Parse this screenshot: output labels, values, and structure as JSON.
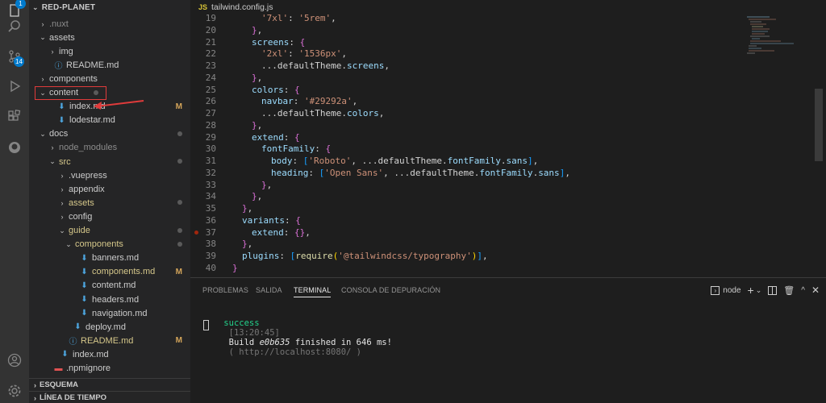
{
  "activity_bar": {
    "explorer_badge": "1",
    "scm_badge": "14",
    "items": [
      "files-icon",
      "search-icon",
      "source-control-icon",
      "run-debug-icon",
      "extensions-icon",
      "github-icon",
      "account-icon",
      "settings-icon"
    ]
  },
  "sidebar": {
    "title": "RED-PLANET",
    "tree": [
      {
        "label": ".nuxt",
        "chev": "›",
        "status": ""
      },
      {
        "label": "assets",
        "chev": "⌄",
        "status": ""
      },
      {
        "label": "img",
        "chev": "›",
        "status": ""
      },
      {
        "label": "README.md",
        "chev": "",
        "status": ""
      },
      {
        "label": "components",
        "chev": "›",
        "status": ""
      },
      {
        "label": "content",
        "chev": "⌄",
        "status": "dot"
      },
      {
        "label": "index.md",
        "chev": "",
        "status": "M"
      },
      {
        "label": "lodestar.md",
        "chev": "",
        "status": ""
      },
      {
        "label": "docs",
        "chev": "⌄",
        "status": "dot"
      },
      {
        "label": "node_modules",
        "chev": "›",
        "status": ""
      },
      {
        "label": "src",
        "chev": "⌄",
        "status": "dot"
      },
      {
        "label": ".vuepress",
        "chev": "›",
        "status": ""
      },
      {
        "label": "appendix",
        "chev": "›",
        "status": ""
      },
      {
        "label": "assets",
        "chev": "›",
        "status": "dot"
      },
      {
        "label": "config",
        "chev": "›",
        "status": ""
      },
      {
        "label": "guide",
        "chev": "⌄",
        "status": "dot"
      },
      {
        "label": "components",
        "chev": "⌄",
        "status": "dot"
      },
      {
        "label": "banners.md",
        "chev": "",
        "status": ""
      },
      {
        "label": "components.md",
        "chev": "",
        "status": "M"
      },
      {
        "label": "content.md",
        "chev": "",
        "status": ""
      },
      {
        "label": "headers.md",
        "chev": "",
        "status": ""
      },
      {
        "label": "navigation.md",
        "chev": "",
        "status": ""
      },
      {
        "label": "deploy.md",
        "chev": "",
        "status": ""
      },
      {
        "label": "README.md",
        "chev": "",
        "status": "M"
      },
      {
        "label": "index.md",
        "chev": "",
        "status": ""
      },
      {
        "label": ".npmignore",
        "chev": "",
        "status": ""
      }
    ],
    "sections": [
      "ESQUEMA",
      "LÍNEA DE TIEMPO"
    ]
  },
  "editor": {
    "tab_label": "tailwind.config.js",
    "tab_icon": "JS",
    "line_numbers": [
      "19",
      "20",
      "21",
      "22",
      "23",
      "24",
      "25",
      "26",
      "27",
      "28",
      "29",
      "30",
      "31",
      "32",
      "33",
      "34",
      "35",
      "36",
      "37",
      "38",
      "39",
      "40"
    ],
    "lines": [
      "'7xl': '5rem',",
      "},",
      "screens: {",
      "'2xl': '1536px',",
      "...defaultTheme.screens,",
      "},",
      "colors: {",
      "navbar: '#29292a',",
      "...defaultTheme.colors,",
      "},",
      "extend: {",
      "fontFamily: {",
      "body: ['Roboto', ...defaultTheme.fontFamily.sans],",
      "heading: ['Open Sans', ...defaultTheme.fontFamily.sans],",
      "},",
      "},",
      "},",
      "variants: {",
      "extend: {},",
      "},",
      "plugins: [require('@tailwindcss/typography')],",
      "}"
    ]
  },
  "panel": {
    "tabs": [
      "PROBLEMAS",
      "SALIDA",
      "TERMINAL",
      "CONSOLA DE DEPURACIÓN"
    ],
    "active_tab": "TERMINAL",
    "terminal_name": "node",
    "terminal": {
      "status_word": "success",
      "timestamp": "[13:20:45]",
      "message_pre": "Build ",
      "hash": "e0b635",
      "message_post": " finished in 646 ms!",
      "url": "( http://localhost:8080/ )"
    }
  },
  "colors": {
    "accent": "#007acc",
    "modified": "#d4a55a",
    "highlight_box": "#e03b3b"
  }
}
